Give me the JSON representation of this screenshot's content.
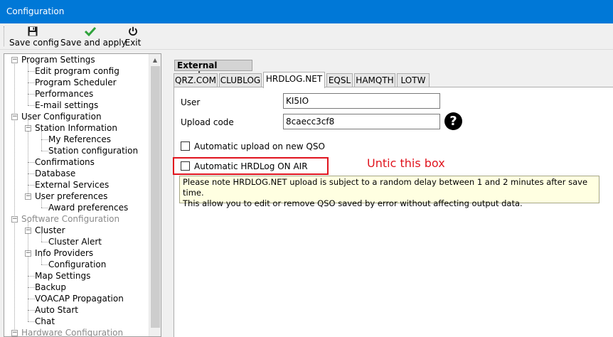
{
  "window": {
    "title": "Configuration"
  },
  "toolbar": {
    "save_config": {
      "label": "Save config",
      "icon": "floppy-disk-icon"
    },
    "save_apply": {
      "label": "Save and apply",
      "icon": "check-mark-icon",
      "color": "#2fa33c"
    },
    "exit": {
      "label": "Exit",
      "icon": "power-icon"
    }
  },
  "tree": {
    "items": [
      {
        "label": "Program Settings",
        "expanded": true
      },
      {
        "label": "Edit program config"
      },
      {
        "label": "Program Scheduler"
      },
      {
        "label": "Performances"
      },
      {
        "label": "E-mail settings"
      },
      {
        "label": "User Configuration",
        "expanded": true
      },
      {
        "label": "Station Information",
        "expanded": true
      },
      {
        "label": "My References"
      },
      {
        "label": "Station configuration"
      },
      {
        "label": "Confirmations"
      },
      {
        "label": "Database"
      },
      {
        "label": "External Services",
        "selected": true
      },
      {
        "label": "User preferences",
        "expanded": true
      },
      {
        "label": "Award preferences"
      },
      {
        "label": "Software Configuration",
        "expanded": true,
        "disabled": true
      },
      {
        "label": "Cluster",
        "expanded": true
      },
      {
        "label": "Cluster Alert"
      },
      {
        "label": "Info Providers",
        "expanded": true
      },
      {
        "label": "Configuration"
      },
      {
        "label": "Map Settings"
      },
      {
        "label": "Backup"
      },
      {
        "label": "VOACAP Propagation"
      },
      {
        "label": "Auto Start"
      },
      {
        "label": "Chat"
      },
      {
        "label": "Hardware Configuration",
        "expanded": true,
        "disabled": true
      }
    ]
  },
  "main": {
    "group_title": "External services",
    "tabs": [
      {
        "label": "QRZ.COM"
      },
      {
        "label": "CLUBLOG"
      },
      {
        "label": "HRDLOG.NET",
        "active": true
      },
      {
        "label": "EQSL"
      },
      {
        "label": "HAMQTH"
      },
      {
        "label": "LOTW"
      }
    ],
    "user_label": "User",
    "user_value": "KI5IO",
    "upload_code_label": "Upload code",
    "upload_code_value": "8caecc3cf8",
    "help_icon": "question-mark-icon",
    "checkbox_auto_upload": {
      "label": "Automatic upload on new QSO",
      "checked": false
    },
    "checkbox_on_air": {
      "label": "Automatic HRDLog ON AIR",
      "checked": false
    },
    "annotation": "Untic this box",
    "note_line1": "Please note HRDLOG.NET upload is subject to a random delay between 1 and 2 minutes after save time.",
    "note_line2": "This allow you to edit or remove QSO saved by error without affecting output data."
  },
  "colors": {
    "titlebar": "#0078d7",
    "annotation": "#e0141e",
    "note_bg": "#ffffe1"
  }
}
